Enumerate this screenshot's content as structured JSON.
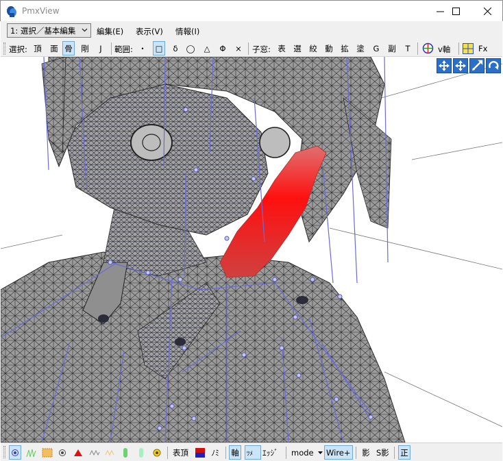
{
  "window": {
    "title": "PmxView",
    "minimize_icon": "minimize-icon",
    "maximize_icon": "maximize-icon",
    "close_icon": "close-icon"
  },
  "menu": {
    "mode_value": "1: 選択／基本編集",
    "items": [
      "編集(E)",
      "表示(V)",
      "情報(I)"
    ]
  },
  "toolbar": {
    "select_label": "選択:",
    "select_items": [
      "頂",
      "面",
      "骨",
      "剛",
      "J"
    ],
    "select_active": "骨",
    "range_label": "範囲:",
    "range_items": [
      "・",
      "□",
      "δ",
      "◯",
      "△",
      "Φ",
      "×"
    ],
    "range_active": "□",
    "subwindow_label": "子窓:",
    "subwindow_items": [
      "表",
      "選",
      "絞",
      "動",
      "拡",
      "塗",
      "G",
      "副",
      "T"
    ],
    "axis_label": "v軸",
    "fx_label": "Fx"
  },
  "view_tools": [
    "move-xy-icon",
    "move-xyz-icon",
    "move-z-icon",
    "rotate-icon"
  ],
  "bottombar": {
    "text_items": [
      "表頂",
      "ﾉﾐ",
      "軸",
      "ｴｯｼﾞ",
      "mode",
      "Wire+",
      "影",
      "S影",
      "正"
    ],
    "active_items": [
      "軸",
      "ﾂﾒ",
      "Wire+",
      "正"
    ],
    "mode_value": "mode",
    "icons": [
      "vertex-dot-icon",
      "wire-grass-icon",
      "texture-icon",
      "circle-icon",
      "red-triangle-icon",
      "wave-icon",
      "light-wave-icon",
      "green-bone-icon",
      "green-capsule-icon",
      "yellow-flower-icon",
      "color-square-icon",
      "nail-icon"
    ]
  },
  "colors": {
    "bone": "#6b6bd8",
    "mesh": "#9a9a9a",
    "wire": "#2a2a2a",
    "selected": "#ff1a1a",
    "active_bg": "#cce4f7"
  }
}
